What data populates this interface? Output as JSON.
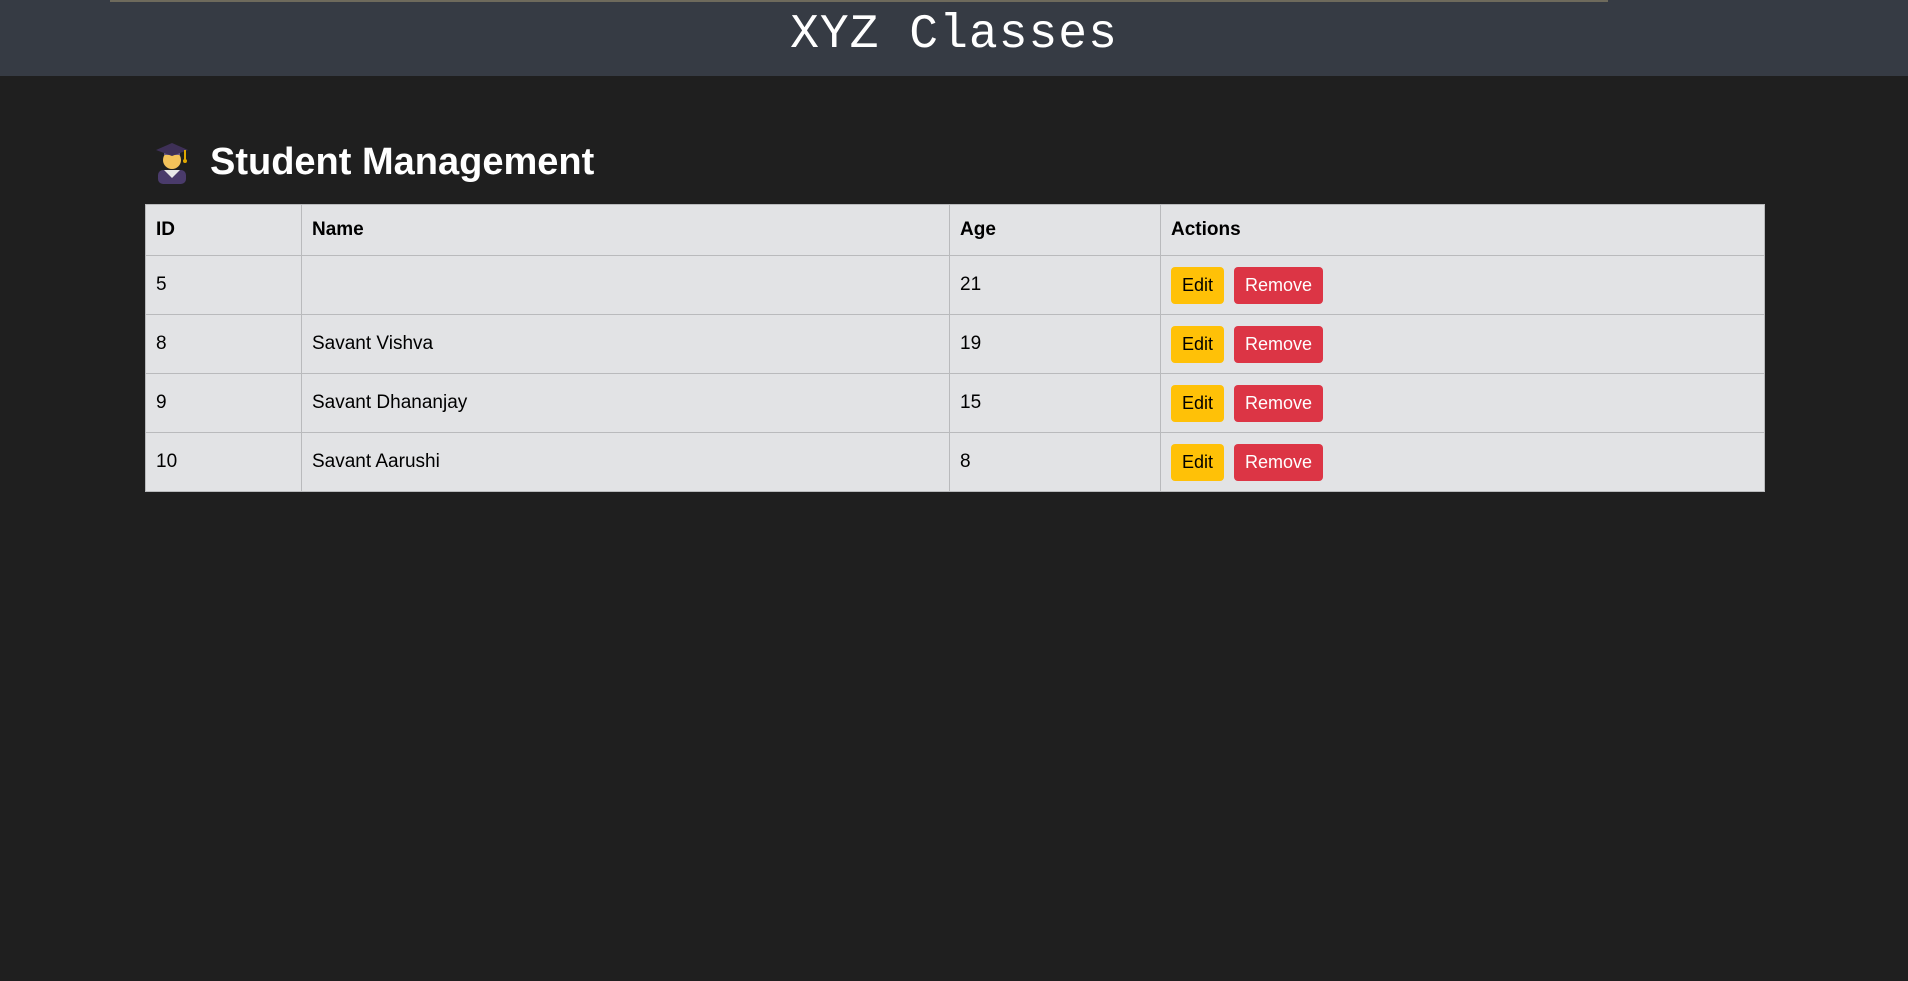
{
  "header": {
    "brand": "XYZ Classes"
  },
  "page": {
    "heading": "Student Management",
    "heading_icon": "graduate-student-icon"
  },
  "table": {
    "columns": [
      "ID",
      "Name",
      "Age",
      "Actions"
    ],
    "rows": [
      {
        "id": "5",
        "name": "",
        "age": "21"
      },
      {
        "id": "8",
        "name": "Savant Vishva",
        "age": "19"
      },
      {
        "id": "9",
        "name": "Savant Dhananjay",
        "age": "15"
      },
      {
        "id": "10",
        "name": "Savant Aarushi",
        "age": "8"
      }
    ],
    "edit_label": "Edit",
    "remove_label": "Remove"
  },
  "colors": {
    "background": "#1f1f1f",
    "topbar": "#363b44",
    "table_bg": "#e2e3e5",
    "edit_button": "#ffc107",
    "remove_button": "#dc3545"
  }
}
